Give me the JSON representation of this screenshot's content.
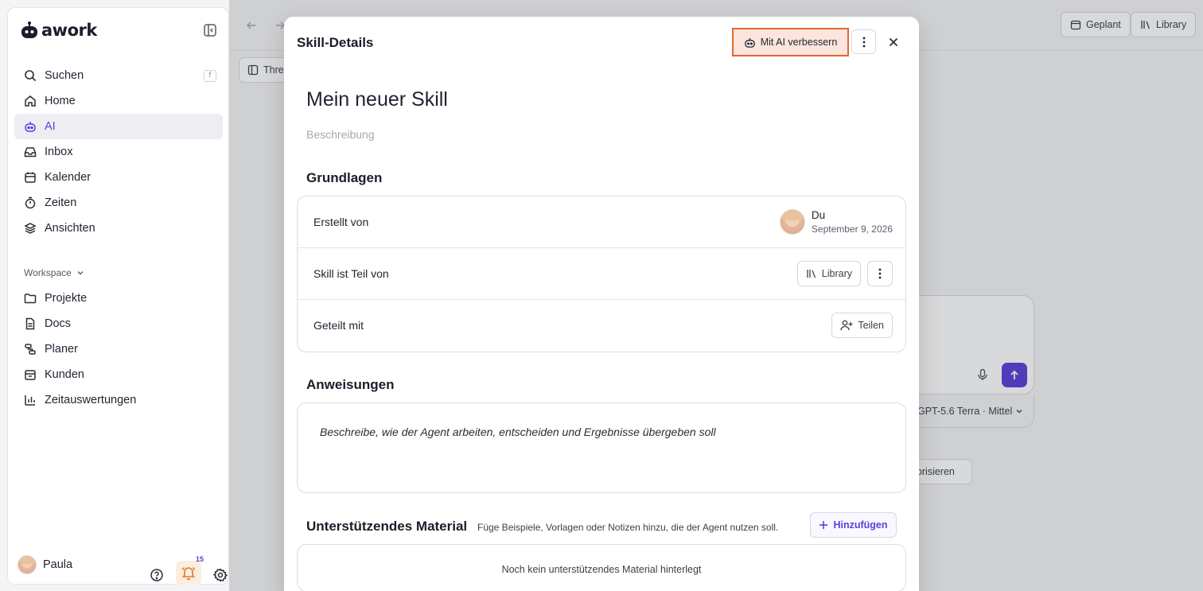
{
  "app": {
    "logo_text": "awork"
  },
  "sidebar": {
    "search": {
      "label": "Suchen",
      "shortcut": "f"
    },
    "items": [
      {
        "label": "Home",
        "icon": "home-icon"
      },
      {
        "label": "AI",
        "icon": "ai-icon",
        "active": true
      },
      {
        "label": "Inbox",
        "icon": "inbox-icon"
      },
      {
        "label": "Kalender",
        "icon": "calendar-icon"
      },
      {
        "label": "Zeiten",
        "icon": "timer-icon"
      },
      {
        "label": "Ansichten",
        "icon": "layers-icon"
      }
    ],
    "workspace_label": "Workspace",
    "workspace_items": [
      {
        "label": "Projekte",
        "icon": "folder-icon"
      },
      {
        "label": "Docs",
        "icon": "doc-icon"
      },
      {
        "label": "Planer",
        "icon": "planner-icon"
      },
      {
        "label": "Kunden",
        "icon": "building-icon"
      },
      {
        "label": "Zeitauswertungen",
        "icon": "chart-icon"
      }
    ],
    "user": {
      "name": "Paula"
    },
    "notification_count": "15"
  },
  "background": {
    "top_chips": {
      "scheduled": "Geplant",
      "library": "Library"
    },
    "thread_chip": "Threa",
    "model_label": "GPT-5.6 Terra · Mittel",
    "prio_chip": "riorisieren"
  },
  "modal": {
    "title": "Skill-Details",
    "ai_button": "Mit AI verbessern",
    "skill_name": "Mein neuer Skill",
    "description_placeholder": "Beschreibung",
    "basics": {
      "heading": "Grundlagen",
      "created_by_label": "Erstellt von",
      "creator_name": "Du",
      "creator_date": "September 9, 2026",
      "part_of_label": "Skill ist Teil von",
      "part_of_button": "Library",
      "shared_with_label": "Geteilt mit",
      "share_button": "Teilen"
    },
    "instructions": {
      "heading": "Anweisungen",
      "placeholder": "Beschreibe, wie der Agent arbeiten, entscheiden und Ergebnisse übergeben soll"
    },
    "material": {
      "heading": "Unterstützendes Material",
      "subtitle": "Füge Beispiele, Vorlagen oder Notizen hinzu, die der Agent nutzen soll.",
      "add_button": "Hinzufügen",
      "empty": "Noch kein unterstützendes Material hinterlegt"
    }
  },
  "colors": {
    "accent": "#5b3fd9",
    "highlight_border": "#e06a2c",
    "highlight_bg": "#fbe5dc"
  }
}
